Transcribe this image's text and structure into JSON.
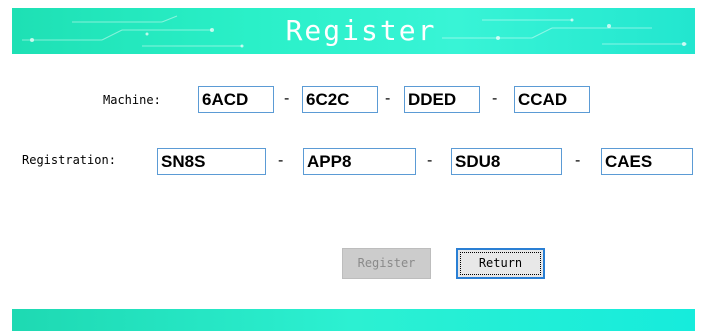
{
  "header": {
    "title": "Register"
  },
  "machine": {
    "label": "Machine:",
    "segments": [
      "6ACD",
      "6C2C",
      "DDED",
      "CCAD"
    ],
    "separator": "-"
  },
  "registration": {
    "label": "Registration:",
    "segments": [
      "SN8S",
      "APP8",
      "SDU8",
      "CAES"
    ],
    "separator": "-"
  },
  "buttons": {
    "register_label": "Register",
    "register_enabled": false,
    "return_label": "Return"
  },
  "colors": {
    "header_start": "#1ee0b4",
    "header_end": "#22e6cf",
    "field_border": "#5b9bd5",
    "focus_border": "#2a7fd4",
    "disabled_bg": "#cccccc"
  }
}
